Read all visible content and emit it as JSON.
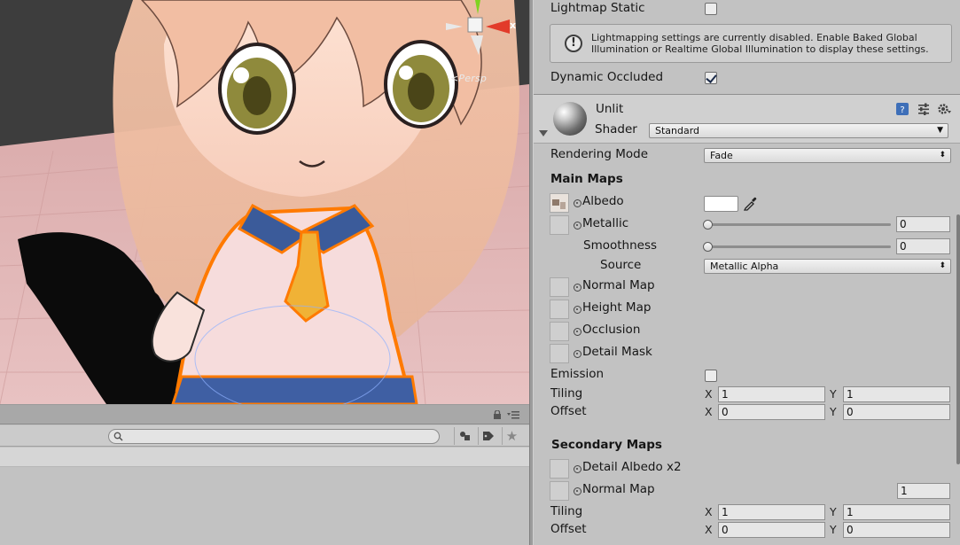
{
  "scene": {
    "view_label": "<Persp",
    "gizmo_axis_label": "x"
  },
  "bottom_panel": {
    "search_placeholder": "",
    "icons": [
      "lock-icon",
      "menu-icon",
      "search-icon",
      "filter-by-type-icon",
      "filter-by-label-icon",
      "favorites-star-icon"
    ]
  },
  "inspector": {
    "lightmap_static": {
      "label": "Lightmap Static",
      "checked": false
    },
    "help_box": {
      "icon": "info-icon",
      "text": "Lightmapping settings are currently disabled. Enable Baked Global Illumination or Realtime Global Illumination to display these settings."
    },
    "dynamic_occluded": {
      "label": "Dynamic Occluded",
      "checked": true
    },
    "material": {
      "name": "Unlit",
      "shader_label": "Shader",
      "shader_value": "Standard",
      "icons": [
        "help-book-icon",
        "presets-icon",
        "settings-gear-icon"
      ]
    },
    "rendering_mode": {
      "label": "Rendering Mode",
      "value": "Fade"
    },
    "main_maps": {
      "heading": "Main Maps",
      "albedo": {
        "label": "Albedo",
        "color": "#ffffff"
      },
      "metallic": {
        "label": "Metallic",
        "value": "0"
      },
      "smoothness": {
        "label": "Smoothness",
        "value": "0"
      },
      "source": {
        "label": "Source",
        "value": "Metallic Alpha"
      },
      "normal_map": {
        "label": "Normal Map"
      },
      "height_map": {
        "label": "Height Map"
      },
      "occlusion": {
        "label": "Occlusion"
      },
      "detail_mask": {
        "label": "Detail Mask"
      },
      "emission": {
        "label": "Emission",
        "checked": false
      },
      "tiling": {
        "label": "Tiling",
        "x_label": "X",
        "x": "1",
        "y_label": "Y",
        "y": "1"
      },
      "offset": {
        "label": "Offset",
        "x_label": "X",
        "x": "0",
        "y_label": "Y",
        "y": "0"
      }
    },
    "secondary_maps": {
      "heading": "Secondary Maps",
      "detail_albedo": {
        "label": "Detail Albedo x2"
      },
      "normal_map": {
        "label": "Normal Map",
        "value": "1"
      },
      "tiling": {
        "label": "Tiling",
        "x_label": "X",
        "x": "1",
        "y_label": "Y",
        "y": "1"
      },
      "offset": {
        "label": "Offset",
        "x_label": "X",
        "x": "0",
        "y_label": "Y",
        "y": "0"
      }
    }
  },
  "colors": {
    "inspector_bg": "#c2c2c2",
    "selection_outline": "#ff7a00",
    "floor": "#e5bcbc"
  }
}
